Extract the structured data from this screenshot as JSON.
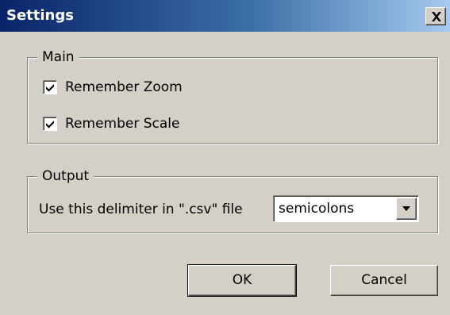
{
  "window": {
    "title": "Settings",
    "close_glyph": "X"
  },
  "main_group": {
    "legend": "Main",
    "remember_zoom": {
      "label": "Remember Zoom",
      "checked": true
    },
    "remember_scale": {
      "label": "Remember Scale",
      "checked": true
    }
  },
  "output_group": {
    "legend": "Output",
    "delimiter_label": "Use this delimiter in \".csv\" file",
    "delimiter_value": "semicolons"
  },
  "buttons": {
    "ok": "OK",
    "cancel": "Cancel"
  },
  "colors": {
    "title_start": "#0a246a",
    "title_end": "#a6caf0",
    "face": "#d4d0c8"
  },
  "icons": {
    "close": "close-icon",
    "check": "checkmark-icon",
    "dropdown": "chevron-down-icon"
  }
}
